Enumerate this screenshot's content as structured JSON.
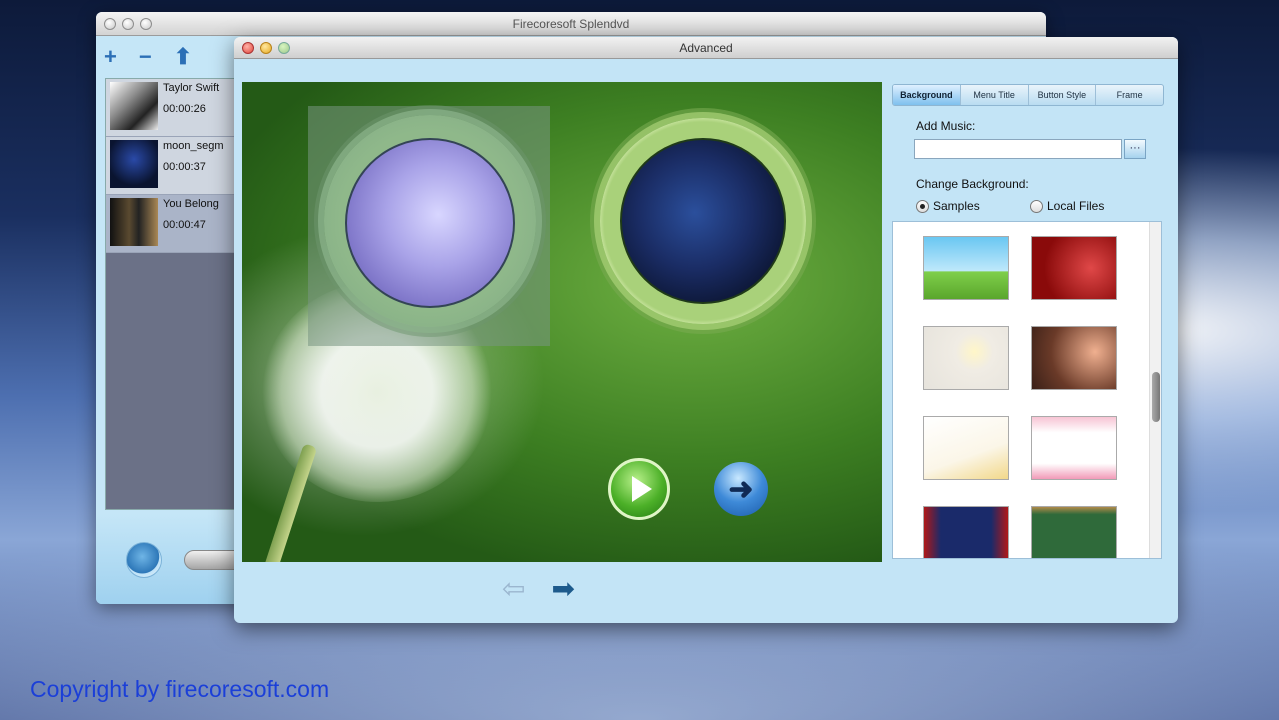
{
  "back_window": {
    "title": "Firecoresoft Splendvd",
    "toolbar": {
      "add": "+",
      "remove": "−",
      "up": "⬆"
    },
    "files": [
      {
        "name": "Taylor Swift",
        "duration": "00:00:26"
      },
      {
        "name": "moon_segm",
        "duration": "00:00:37"
      },
      {
        "name": "You Belong",
        "duration": "00:00:47"
      }
    ]
  },
  "front_window": {
    "title": "Advanced",
    "preview_nav": {
      "prev": "⇦",
      "next": "➡"
    },
    "menu_buttons": {
      "play": "play-icon",
      "next": "➜"
    },
    "tabs": [
      {
        "label": "Background",
        "active": true
      },
      {
        "label": "Menu Title",
        "active": false
      },
      {
        "label": "Button Style",
        "active": false
      },
      {
        "label": "Frame",
        "active": false
      }
    ],
    "add_music_label": "Add Music:",
    "music_value": "",
    "browse_label": "···",
    "change_background_label": "Change Background:",
    "radio_samples": "Samples",
    "radio_local": "Local Files",
    "selected_source": "Samples"
  },
  "footer": {
    "copyright": "Copyright by firecoresoft.com"
  }
}
